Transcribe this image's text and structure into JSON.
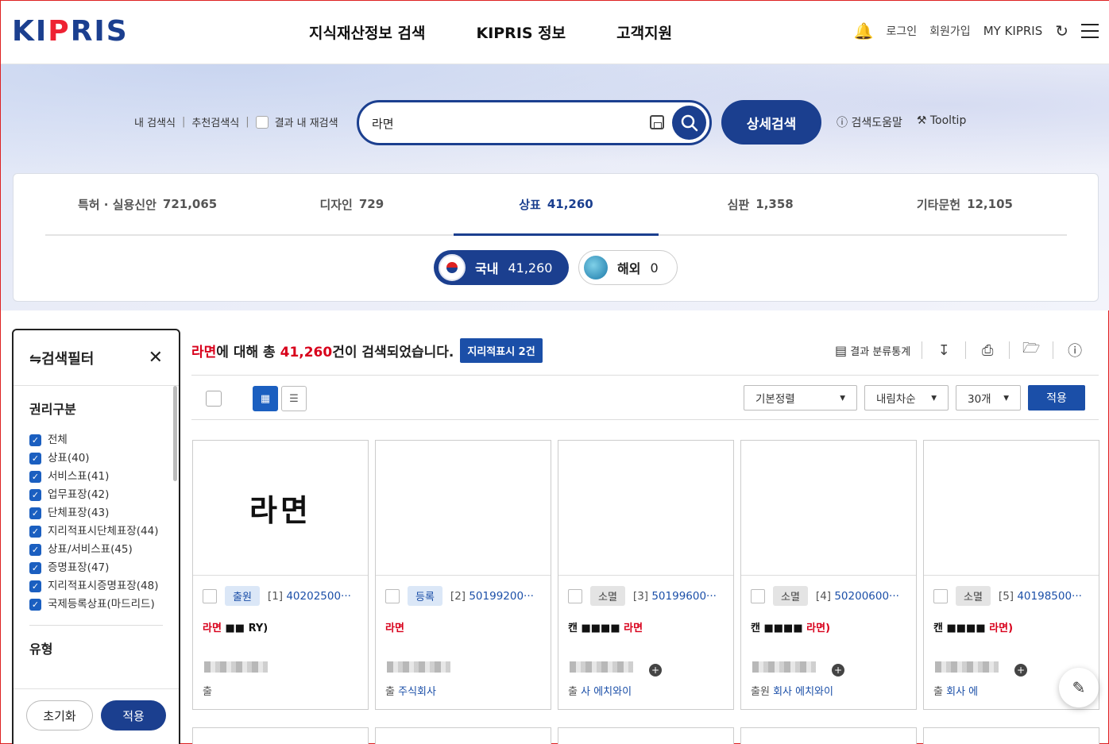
{
  "header": {
    "logo": "KIPRIS",
    "gnb": [
      "지식재산정보 검색",
      "KIPRIS 정보",
      "고객지원"
    ],
    "util": {
      "login": "로그인",
      "join": "회원가입",
      "mykipris": "MY KIPRIS"
    }
  },
  "search": {
    "links": [
      "내 검색식",
      "추천검색식",
      "결과 내 재검색"
    ],
    "value": "라면",
    "advanced": "상세검색",
    "help": "검색도움말",
    "tooltip": "Tooltip"
  },
  "tabs": [
    {
      "label": "특허 · 실용신안",
      "count": "721,065"
    },
    {
      "label": "디자인",
      "count": "729"
    },
    {
      "label": "상표",
      "count": "41,260",
      "active": true
    },
    {
      "label": "심판",
      "count": "1,358"
    },
    {
      "label": "기타문헌",
      "count": "12,105"
    }
  ],
  "region": {
    "domestic": {
      "label": "국내",
      "count": "41,260"
    },
    "overseas": {
      "label": "해외",
      "count": "0"
    }
  },
  "filter": {
    "title": "검색필터",
    "section1": "권리구분",
    "items": [
      "전체",
      "상표(40)",
      "서비스표(41)",
      "업무표장(42)",
      "단체표장(43)",
      "지리적표시단체표장(44)",
      "상표/서비스표(45)",
      "증명표장(47)",
      "지리적표시증명표장(48)",
      "국제등록상표(마드리드)"
    ],
    "section2": "유형",
    "reset": "초기화",
    "apply": "적용"
  },
  "result": {
    "keyword": "라면",
    "pre": "에 대해 총",
    "count": "41,260",
    "post": "건이 검색되었습니다.",
    "geo": "지리적표시 2건",
    "stats": "결과 분류통계",
    "sort": "기본정렬",
    "order": "내림차순",
    "per_page": "30개",
    "apply": "적용"
  },
  "cards": [
    {
      "img": "라면",
      "status": "출원",
      "idx": "[1]",
      "number": "40202500···",
      "name": "라면",
      "name_tail": "RY)",
      "owner_prefix": "출",
      "owner": ""
    },
    {
      "img": "",
      "status": "등록",
      "idx": "[2]",
      "number": "50199200···",
      "name": "라면",
      "name_tail": "",
      "owner_prefix": "출",
      "owner": "주식회사"
    },
    {
      "img": "",
      "status": "소멸",
      "idx": "[3]",
      "number": "50199600···",
      "name": "라면",
      "name_tail": "",
      "owner_prefix": "출",
      "owner": "사 에치와이"
    },
    {
      "img": "",
      "status": "소멸",
      "idx": "[4]",
      "number": "50200600···",
      "name": "라면)",
      "name_tail": "",
      "owner_prefix": "출원",
      "owner": "회사 에치와이"
    },
    {
      "img": "",
      "status": "소멸",
      "idx": "[5]",
      "number": "40198500···",
      "name": "라면)",
      "name_tail": "",
      "owner_prefix": "출",
      "owner": "회사 에"
    }
  ]
}
